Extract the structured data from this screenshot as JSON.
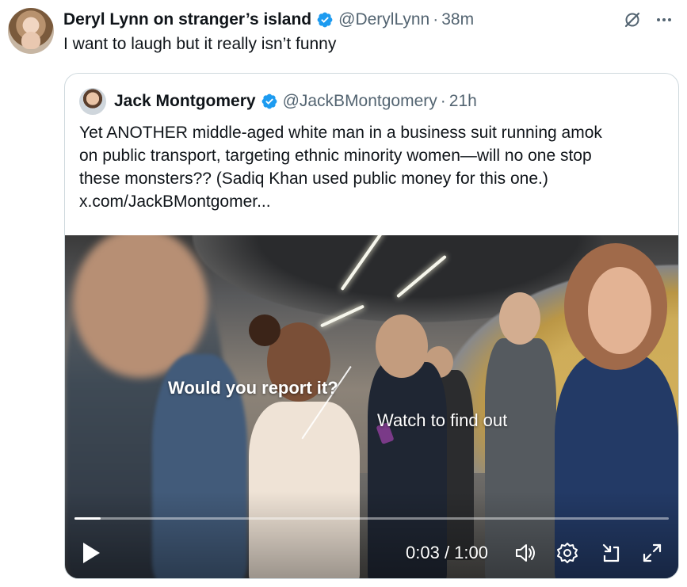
{
  "tweet": {
    "author": {
      "display_name": "Deryl Lynn on stranger’s island",
      "handle": "@DerylLynn",
      "time": "38m",
      "verified": true
    },
    "separator": "·",
    "text": "I want to laugh but it really isn’t funny",
    "icons": [
      "grok-icon",
      "more-icon"
    ]
  },
  "quote": {
    "author": {
      "display_name": "Jack Montgomery",
      "handle": "@JackBMontgomery",
      "time": "21h",
      "verified": true
    },
    "separator": "·",
    "text_lines": [
      "Yet ANOTHER middle-aged white man in a business suit running amok",
      "on public transport, targeting ethnic minority women—will no one stop",
      "these monsters?? (Sadiq Khan used public money for this one.)",
      "x.com/JackBMontgomer..."
    ]
  },
  "video": {
    "caption_1": "Would you report it?",
    "caption_2": "Watch to find out",
    "current_time": "0:03",
    "duration": "1:00",
    "time_separator": " / ",
    "progress_fraction": 0.044,
    "controls": [
      "play-icon",
      "volume-icon",
      "settings-icon",
      "minimize-icon",
      "fullscreen-icon"
    ]
  },
  "colors": {
    "verified_blue": "#1d9bf0",
    "secondary_text": "#536471",
    "border": "#cfd9de"
  }
}
